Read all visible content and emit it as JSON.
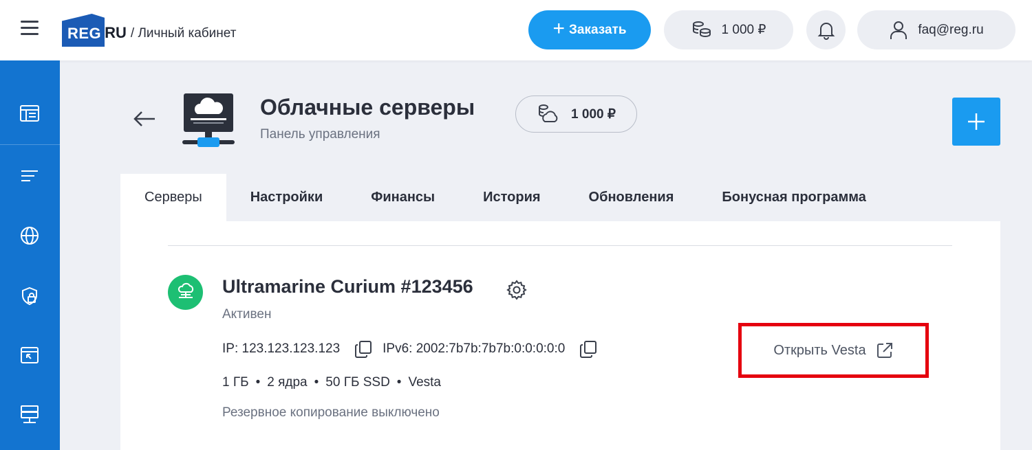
{
  "header": {
    "logo_reg": "REG",
    "logo_ru": ".RU",
    "breadcrumb": "/ Личный кабинет",
    "order_label": "Заказать",
    "balance": "1 000 ₽",
    "user_email": "faq@reg.ru"
  },
  "sidebar": {
    "icons": [
      "dashboard-icon",
      "list-icon",
      "globe-icon",
      "ssl-lock-icon",
      "site-builder-icon",
      "server-icon"
    ]
  },
  "page": {
    "title": "Облачные серверы",
    "subtitle": "Панель управления",
    "balance": "1 000 ₽"
  },
  "tabs": [
    {
      "label": "Серверы",
      "active": true
    },
    {
      "label": "Настройки",
      "active": false
    },
    {
      "label": "Финансы",
      "active": false
    },
    {
      "label": "История",
      "active": false
    },
    {
      "label": "Обновления",
      "active": false
    },
    {
      "label": "Бонусная программа",
      "active": false
    }
  ],
  "server": {
    "name": "Ultramarine Curium #123456",
    "status": "Активен",
    "ip_label": "IP: 123.123.123.123",
    "ipv6_label": "IPv6: 2002:7b7b:7b7b:0:0:0:0:0",
    "specs": [
      "1 ГБ",
      "2 ядра",
      "50 ГБ SSD",
      "Vesta"
    ],
    "spec_separator": "•",
    "backup": "Резервное копирование выключено",
    "open_panel_label": "Открыть Vesta"
  },
  "colors": {
    "brand_blue": "#1374d0",
    "accent_blue": "#1a9bf0",
    "status_green": "#1dbf73",
    "highlight_red": "#e5000e"
  }
}
